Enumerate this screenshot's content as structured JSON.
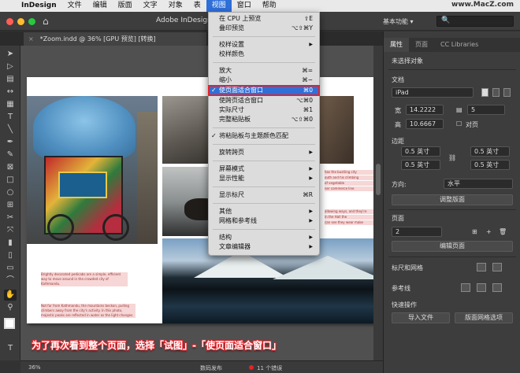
{
  "menubar": {
    "app": "InDesign",
    "items": [
      "文件",
      "编辑",
      "版面",
      "文字",
      "对象",
      "表",
      "视图",
      "窗口",
      "帮助"
    ],
    "active": "视图",
    "watermark": "www.MacZ.com"
  },
  "window": {
    "title": "Adobe InDesign",
    "workspace": "基本功能 ▾",
    "search_placeholder": "🔍"
  },
  "doc": {
    "tab": "*Zoom.indd @ 36% [GPU 预览] [转换]",
    "tab_close": "×"
  },
  "captions": {
    "c1": "Brightly decorated pedicabs are a simple, efficient way to move around in the crowded city of Kathmandu.",
    "c2": "Not far from Kathmandu, the mountains beckon, pulling climbers away from the city's activity. In this photo, majestic peaks are reflected in water as the light changes.",
    "c3": "has the bustling city",
    "c4": "outh and his climbing",
    "c5": "of vegetable",
    "c5b": "ner commerce line",
    "c6": "allowing ways, and they're",
    "c7": "in the Hall the",
    "c8": "can see they wear make"
  },
  "view_menu": {
    "items": [
      {
        "label": "在 CPU 上预览",
        "shortcut": "⇧E"
      },
      {
        "label": "叠印预览",
        "shortcut": "⌥⇧⌘Y"
      },
      {
        "label": "校样设置",
        "submenu": "▶"
      },
      {
        "label": "校样颜色"
      },
      {
        "label": "放大",
        "shortcut": "⌘="
      },
      {
        "label": "缩小",
        "shortcut": "⌘−"
      },
      {
        "label": "使页面适合窗口",
        "shortcut": "⌘0",
        "check": "✓"
      },
      {
        "label": "使跨页适合窗口",
        "shortcut": "⌥⌘0"
      },
      {
        "label": "实际尺寸",
        "shortcut": "⌘1"
      },
      {
        "label": "完整粘贴板",
        "shortcut": "⌥⇧⌘0"
      },
      {
        "label": "将粘贴板与主题颜色匹配",
        "check": "✓"
      },
      {
        "label": "旋转跨页",
        "submenu": "▶"
      },
      {
        "label": "屏幕模式",
        "submenu": "▶"
      },
      {
        "label": "显示性能",
        "submenu": "▶"
      },
      {
        "label": "显示标尺",
        "shortcut": "⌘R"
      },
      {
        "label": "其他",
        "submenu": "▶"
      },
      {
        "label": "网格和参考线",
        "submenu": "▶"
      },
      {
        "label": "结构",
        "submenu": "▶"
      },
      {
        "label": "文章编辑器",
        "submenu": "▶"
      }
    ]
  },
  "panel": {
    "tabs": [
      "属性",
      "页面",
      "CC Libraries"
    ],
    "no_selection": "未选择对象",
    "document": "文档",
    "preset": "iPad",
    "width_label": "宽",
    "width": "14.2222",
    "height_label": "高",
    "height": "10.6667",
    "pages": "5",
    "facing": "对页",
    "margins": "边距",
    "m1": "0.5 英寸",
    "m2": "0.5 英寸",
    "m3": "0.5 英寸",
    "m4": "0.5 英寸",
    "direction": "方向:",
    "orientation": "水平",
    "adjust_layout": "调整版面",
    "page_section": "页面",
    "page_num": "2",
    "edit_page": "编辑页面",
    "rulers_grids": "标尺和网格",
    "guides": "参考线",
    "quick_actions": "快速操作",
    "import_file": "导入文件",
    "layout_grid": "版面网格选项"
  },
  "status": {
    "zoom": "36%",
    "publish": "数码发布",
    "errors": "11 个错误"
  },
  "banner": "为了再次看到整个页面，选择「试图」-「使页面适合窗口」"
}
